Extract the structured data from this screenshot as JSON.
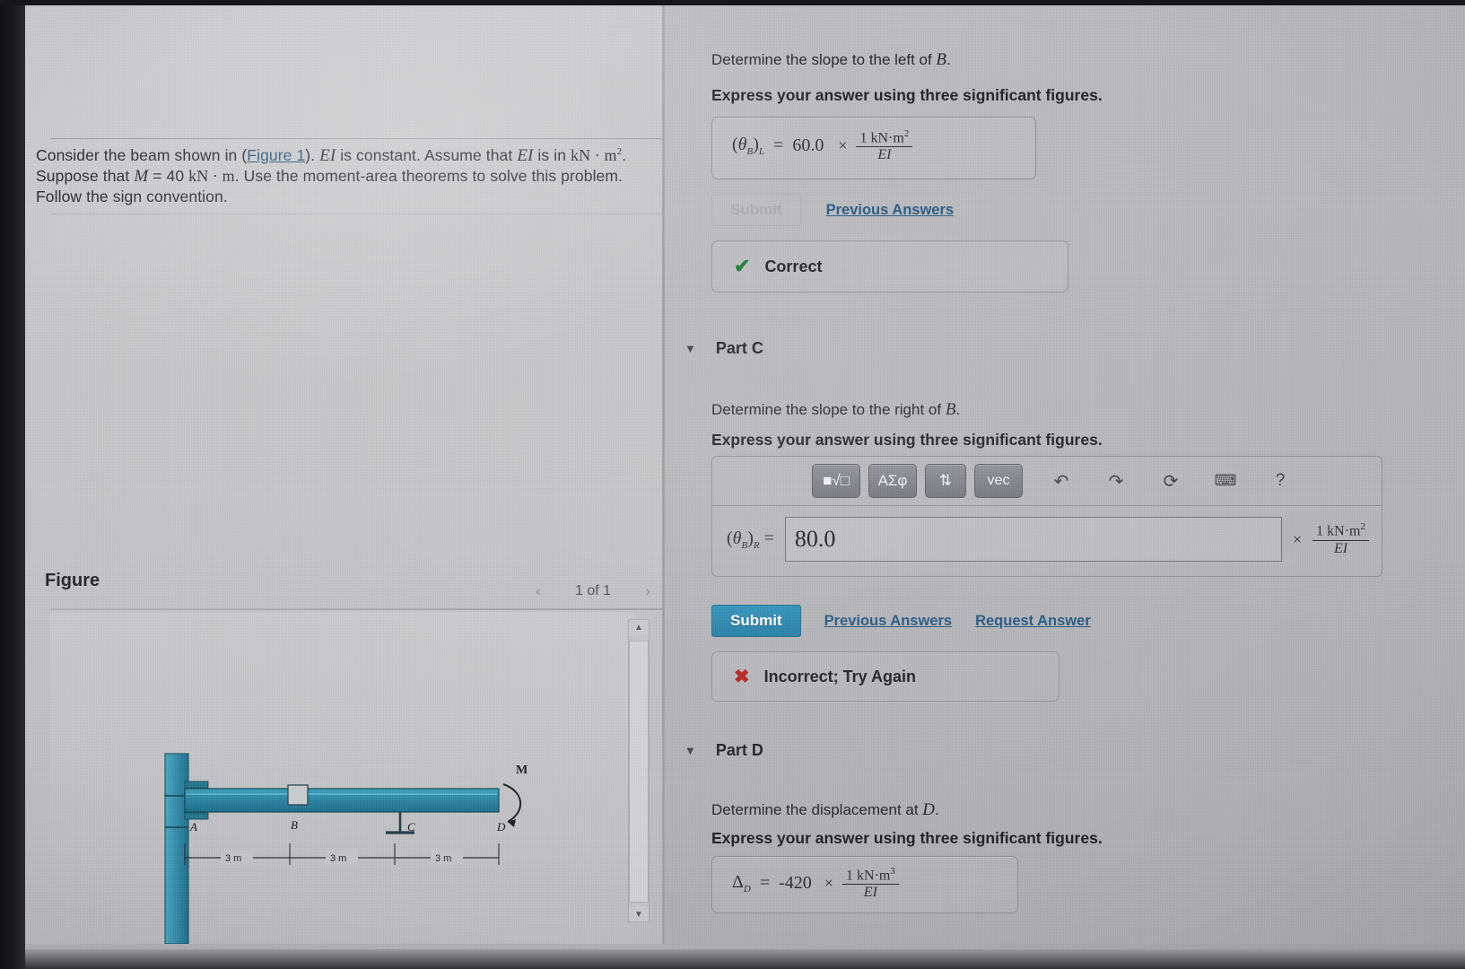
{
  "problem": {
    "line1_a": "Consider the beam shown in (",
    "figure_link": "Figure 1",
    "line1_b": "). ",
    "ei_1": "EI",
    "line1_c": " is constant. Assume that ",
    "ei_2": "EI",
    "line1_d": " is in ",
    "units_knm2": "kN · m",
    "units_exp": "2",
    "line1_e": ".",
    "line2_a": "Suppose that ",
    "m_var": "M",
    "line2_b": " = 40 ",
    "units_knm": "kN · m",
    "line2_c": ". Use the moment-area theorems to solve this problem.",
    "line3": "Follow the sign convention."
  },
  "figure": {
    "title": "Figure",
    "nav_prev": "‹",
    "nav_counter": "1 of 1",
    "nav_next": "›",
    "beam": {
      "labels": [
        "A",
        "B",
        "C",
        "D"
      ],
      "moment_label": "M",
      "segments": [
        "3 m",
        "3 m",
        "3 m"
      ],
      "supports": [
        "fixed-wall",
        "internal-hinge",
        "roller",
        "free-end-moment"
      ],
      "beam_color": "#2e8aa8"
    },
    "scroll_up": "▲",
    "scroll_down": "▼"
  },
  "part_b": {
    "question": "Determine the slope to the left of ",
    "question_var": "B",
    "question_end": ".",
    "instruction": "Express your answer using three significant figures.",
    "answer_symbol_open": "(",
    "answer_symbol_theta": "θ",
    "answer_symbol_sub": "B",
    "answer_symbol_close": ")",
    "answer_symbol_side": "L",
    "equals": "=",
    "value": "60.0",
    "times": "×",
    "unit_num": "1 kN·m",
    "unit_num_exp": "2",
    "unit_den": "EI",
    "submit_label": "Submit",
    "previous_answers_label": "Previous Answers",
    "feedback_icon": "check-icon",
    "feedback_text": "Correct"
  },
  "part_c": {
    "header": "Part C",
    "caret": "▼",
    "question": "Determine the slope to the right of ",
    "question_var": "B",
    "question_end": ".",
    "instruction": "Express your answer using three significant figures.",
    "toolbar": [
      {
        "name": "template-root-button",
        "label": "■√□"
      },
      {
        "name": "greek-symbols-button",
        "label": "ΑΣφ"
      },
      {
        "name": "updown-arrows-button",
        "label": "⇅"
      },
      {
        "name": "vector-button",
        "label": "vec"
      },
      {
        "name": "undo-icon",
        "label": "↶"
      },
      {
        "name": "redo-icon",
        "label": "↷"
      },
      {
        "name": "reset-icon",
        "label": "⟳"
      },
      {
        "name": "keyboard-icon",
        "label": "⌨"
      },
      {
        "name": "help-icon",
        "label": "?"
      }
    ],
    "answer_symbol_open": "(",
    "answer_symbol_theta": "θ",
    "answer_symbol_sub": "B",
    "answer_symbol_close": ")",
    "answer_symbol_side": "R",
    "equals": "=",
    "input_value": "80.0",
    "times": "×",
    "unit_num": "1 kN·m",
    "unit_num_exp": "2",
    "unit_den": "EI",
    "submit_label": "Submit",
    "previous_answers_label": "Previous Answers",
    "request_answer_label": "Request Answer",
    "feedback_icon": "cross-icon",
    "feedback_text": "Incorrect; Try Again"
  },
  "part_d": {
    "header": "Part D",
    "caret": "▼",
    "question": "Determine the displacement at ",
    "question_var": "D",
    "question_end": ".",
    "instruction": "Express your answer using three significant figures.",
    "answer_symbol": "Δ",
    "answer_symbol_sub": "D",
    "equals": "=",
    "value": "-420",
    "times": "×",
    "unit_num": "1 kN·m",
    "unit_num_exp": "3",
    "unit_den": "EI"
  },
  "colors": {
    "submit_blue": "#1f7ba4",
    "link_blue": "#1f5580",
    "correct_green": "#157a2f",
    "incorrect_red": "#b3221b",
    "beam_teal": "#2e8aa8"
  }
}
